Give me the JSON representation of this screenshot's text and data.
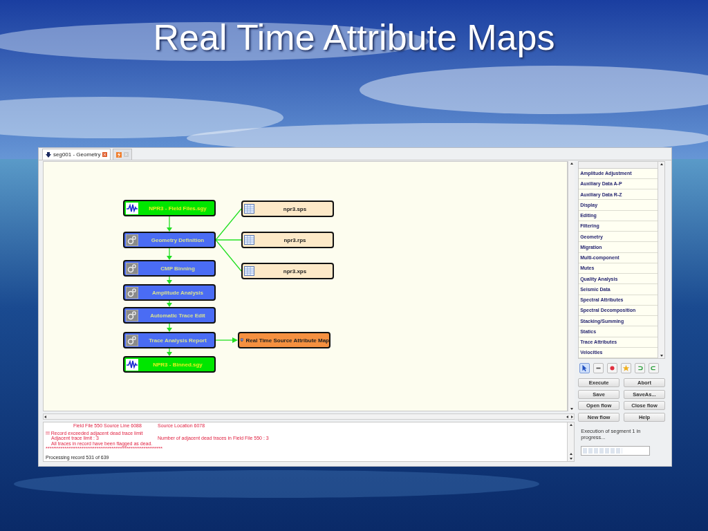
{
  "slide": {
    "title": "Real Time Attribute Maps"
  },
  "tabs": [
    {
      "label": "seg001 - Geometry",
      "selected": true
    },
    {
      "selected": false
    }
  ],
  "flow": [
    {
      "label": "NPR3 - Field Files.sgy",
      "kind": "data"
    },
    {
      "label": "Geometry Definition",
      "kind": "process",
      "attachments": [
        {
          "label": "npr3.sps",
          "kind": "table"
        },
        {
          "label": "npr3.rps",
          "kind": "table"
        },
        {
          "label": "npr3.xps",
          "kind": "table"
        }
      ]
    },
    {
      "label": "CMP Binning",
      "kind": "process"
    },
    {
      "label": "Amplitude Analysis",
      "kind": "process"
    },
    {
      "label": "Automatic Trace Edit",
      "kind": "process"
    },
    {
      "label": "Trace Analysis Report",
      "kind": "process",
      "attachments": [
        {
          "label": "Real Time Source Attribute Map",
          "kind": "map"
        }
      ]
    },
    {
      "label": "NPR3 - Binned.sgy",
      "kind": "data"
    }
  ],
  "log": [
    {
      "kind": "header",
      "text": "Field File 550   Source Line 6088",
      "aside": "Source Location 6078"
    },
    {
      "kind": "error",
      "text": "!!! Record exceeded adjacent dead trace limit"
    },
    {
      "kind": "detail",
      "text": "Adjacent trace limit : 3",
      "aside": "Number of adjacent dead traces in Field File 550 : 3"
    },
    {
      "kind": "detail",
      "text": "All traces in record have been flagged as dead."
    },
    {
      "kind": "rule",
      "text": "**************************************************************"
    },
    {
      "kind": "info",
      "text": "Processing record 531 of 639"
    }
  ],
  "categories": [
    "Amplitude Adjustment",
    "Auxiliary Data A-P",
    "Auxiliary Data R-Z",
    "Display",
    "Editing",
    "Filtering",
    "Geometry",
    "Migration",
    "Multi-component",
    "Mutes",
    "Quality Analysis",
    "Seismic Data",
    "Spectral Attributes",
    "Spectral Decomposition",
    "Stacking/Summing",
    "Statics",
    "Trace Attributes",
    "Velocities"
  ],
  "tools": [
    {
      "kind": "pointer",
      "selected": true
    },
    {
      "kind": "minus",
      "selected": false
    },
    {
      "kind": "record",
      "selected": false
    },
    {
      "kind": "star",
      "selected": false
    },
    {
      "kind": "undo",
      "selected": false
    },
    {
      "kind": "redo",
      "selected": false
    }
  ],
  "buttons": [
    "Execute",
    "Abort",
    "Save",
    "SaveAs...",
    "Open flow",
    "Close flow",
    "New flow",
    "Help"
  ],
  "status": {
    "text": "Execution of segment 1 in progress...",
    "level": 0.6
  }
}
